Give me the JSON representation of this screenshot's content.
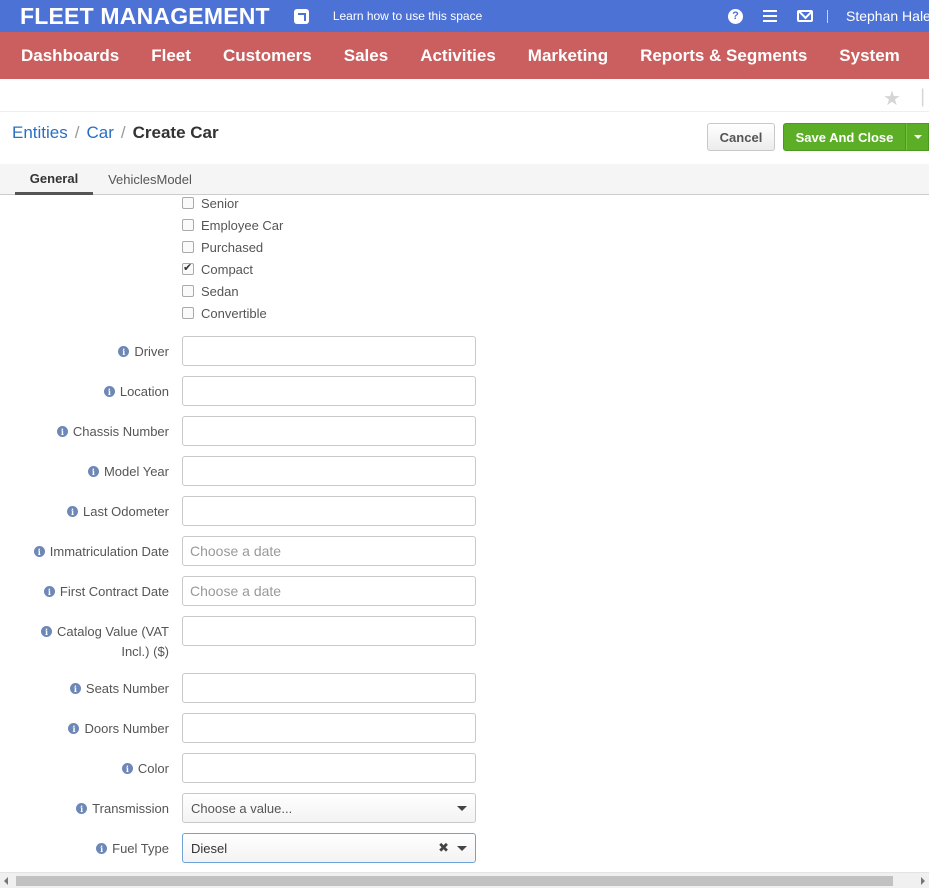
{
  "topbar": {
    "title": "FLEET MANAGEMENT",
    "learn_link": "Learn how to use this space",
    "user_name": "Stephan Hale",
    "help_glyph": "?",
    "color": "#4d72d6"
  },
  "nav": {
    "items": [
      "Dashboards",
      "Fleet",
      "Customers",
      "Sales",
      "Activities",
      "Marketing",
      "Reports & Segments",
      "System"
    ],
    "color": "#cb5f5f"
  },
  "breadcrumb": {
    "items": [
      "Entities",
      "Car"
    ],
    "separator": "/",
    "current": "Create Car"
  },
  "actions": {
    "cancel_label": "Cancel",
    "save_label": "Save And Close",
    "save_color": "#5cae26"
  },
  "tabs": [
    "General",
    "VehiclesModel"
  ],
  "checkboxes": [
    {
      "label": "Senior",
      "checked": false
    },
    {
      "label": "Employee Car",
      "checked": false
    },
    {
      "label": "Purchased",
      "checked": false
    },
    {
      "label": "Compact",
      "checked": true
    },
    {
      "label": "Sedan",
      "checked": false
    },
    {
      "label": "Convertible",
      "checked": false
    }
  ],
  "fields": {
    "driver": {
      "label": "Driver",
      "value": ""
    },
    "location": {
      "label": "Location",
      "value": ""
    },
    "chassis": {
      "label": "Chassis Number",
      "value": ""
    },
    "model_year": {
      "label": "Model Year",
      "value": ""
    },
    "last_odometer": {
      "label": "Last Odometer",
      "value": ""
    },
    "immatriculation": {
      "label": "Immatriculation Date",
      "placeholder": "Choose a date"
    },
    "first_contract": {
      "label": "First Contract Date",
      "placeholder": "Choose a date"
    },
    "catalog_value": {
      "label_line1": "Catalog Value (VAT",
      "label_line2": "Incl.) ($)",
      "value": ""
    },
    "seats": {
      "label": "Seats Number",
      "value": ""
    },
    "doors": {
      "label": "Doors Number",
      "value": ""
    },
    "color": {
      "label": "Color",
      "value": ""
    },
    "transmission": {
      "label": "Transmission",
      "placeholder": "Choose a value..."
    },
    "fuel_type": {
      "label": "Fuel Type",
      "value": "Diesel"
    }
  },
  "icons": {
    "info": "i",
    "clear": "✖",
    "star": "★",
    "pin": "📌"
  }
}
